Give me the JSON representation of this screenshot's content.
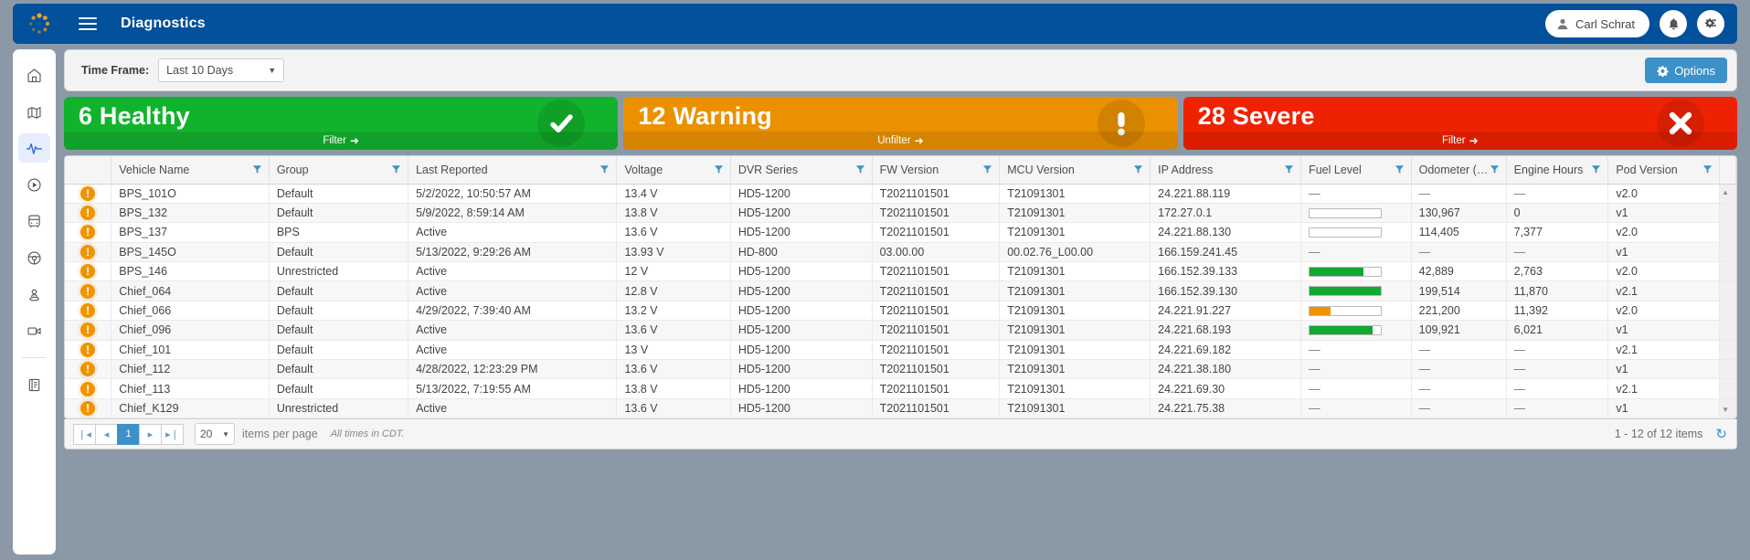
{
  "topbar": {
    "logo": "spinner-logo",
    "menu_icon": "hamburger-menu-icon",
    "title": "Diagnostics",
    "user_name": "Carl Schrat",
    "user_icon": "user-icon",
    "bell_icon": "bell-icon",
    "gear_icon": "gear-icon"
  },
  "sidebar": {
    "items": [
      {
        "name": "home",
        "icon": "home-icon",
        "active": false
      },
      {
        "name": "map",
        "icon": "map-icon",
        "active": false
      },
      {
        "name": "diagnostics",
        "icon": "pulse-icon",
        "active": true
      },
      {
        "name": "playback",
        "icon": "play-circle-icon",
        "active": false
      },
      {
        "name": "vehicles",
        "icon": "bus-icon",
        "active": false
      },
      {
        "name": "drivers",
        "icon": "steering-wheel-icon",
        "active": false
      },
      {
        "name": "students",
        "icon": "person-pin-icon",
        "active": false
      },
      {
        "name": "video",
        "icon": "video-camera-icon",
        "active": false
      },
      {
        "name": "reports",
        "icon": "report-book-icon",
        "active": false
      }
    ]
  },
  "filterbar": {
    "time_frame_label": "Time Frame:",
    "time_frame_value": "Last 10 Days",
    "options_label": "Options",
    "options_icon": "gear-icon"
  },
  "cards": [
    {
      "count": "6",
      "label": "Healthy",
      "title": "6 Healthy",
      "action": "Filter",
      "arrow": "→",
      "icon": "check-circle-icon",
      "color": "#12b32c"
    },
    {
      "count": "12",
      "label": "Warning",
      "title": "12 Warning",
      "action": "Unfilter",
      "arrow": "→",
      "icon": "exclamation-icon",
      "color": "#eb9100"
    },
    {
      "count": "28",
      "label": "Severe",
      "title": "28 Severe",
      "action": "Filter",
      "arrow": "→",
      "icon": "x-circle-icon",
      "color": "#ef2200"
    }
  ],
  "table": {
    "columns": [
      {
        "label": "",
        "filterable": false
      },
      {
        "label": "Vehicle Name",
        "filterable": true
      },
      {
        "label": "Group",
        "filterable": true
      },
      {
        "label": "Last Reported",
        "filterable": true
      },
      {
        "label": "Voltage",
        "filterable": true
      },
      {
        "label": "DVR Series",
        "filterable": true
      },
      {
        "label": "FW Version",
        "filterable": true
      },
      {
        "label": "MCU Version",
        "filterable": true
      },
      {
        "label": "IP Address",
        "filterable": true
      },
      {
        "label": "Fuel Level",
        "filterable": true
      },
      {
        "label": "Odometer (…",
        "filterable": true
      },
      {
        "label": "Engine Hours",
        "filterable": true
      },
      {
        "label": "Pod Version",
        "filterable": true
      }
    ],
    "rows": [
      {
        "status": "warning",
        "vehicle_name": "BPS_101O",
        "group": "Default",
        "last_reported": "5/2/2022, 10:50:57 AM",
        "voltage": "13.4 V",
        "dvr_series": "HD5-1200",
        "fw_version": "T2021101501",
        "mcu_version": "T21091301",
        "ip_address": "24.221.88.119",
        "fuel_level": null,
        "fuel_text": "—",
        "odometer": "—",
        "engine_hours": "—",
        "pod_version": "v2.0"
      },
      {
        "status": "warning",
        "vehicle_name": "BPS_132",
        "group": "Default",
        "last_reported": "5/9/2022, 8:59:14 AM",
        "voltage": "13.8 V",
        "dvr_series": "HD5-1200",
        "fw_version": "T2021101501",
        "mcu_version": "T21091301",
        "ip_address": "172.27.0.1",
        "fuel_level": 0,
        "fuel_text": "",
        "odometer": "130,967",
        "engine_hours": "0",
        "pod_version": "v1"
      },
      {
        "status": "warning",
        "vehicle_name": "BPS_137",
        "group": "BPS",
        "last_reported": "Active",
        "voltage": "13.6 V",
        "dvr_series": "HD5-1200",
        "fw_version": "T2021101501",
        "mcu_version": "T21091301",
        "ip_address": "24.221.88.130",
        "fuel_level": 0,
        "fuel_text": "",
        "odometer": "114,405",
        "engine_hours": "7,377",
        "pod_version": "v2.0"
      },
      {
        "status": "warning",
        "vehicle_name": "BPS_145O",
        "group": "Default",
        "last_reported": "5/13/2022, 9:29:26 AM",
        "voltage": "13.93 V",
        "dvr_series": "HD-800",
        "fw_version": "03.00.00",
        "mcu_version": "00.02.76_L00.00",
        "ip_address": "166.159.241.45",
        "fuel_level": null,
        "fuel_text": "—",
        "odometer": "—",
        "engine_hours": "—",
        "pod_version": "v1"
      },
      {
        "status": "warning",
        "vehicle_name": "BPS_146",
        "group": "Unrestricted",
        "last_reported": "Active",
        "voltage": "12 V",
        "dvr_series": "HD5-1200",
        "fw_version": "T2021101501",
        "mcu_version": "T21091301",
        "ip_address": "166.152.39.133",
        "fuel_level": 75,
        "fuel_color": "#12a833",
        "fuel_text": "",
        "odometer": "42,889",
        "engine_hours": "2,763",
        "pod_version": "v2.0"
      },
      {
        "status": "warning",
        "vehicle_name": "Chief_064",
        "group": "Default",
        "last_reported": "Active",
        "voltage": "12.8 V",
        "dvr_series": "HD5-1200",
        "fw_version": "T2021101501",
        "mcu_version": "T21091301",
        "ip_address": "166.152.39.130",
        "fuel_level": 100,
        "fuel_color": "#12a833",
        "fuel_text": "",
        "odometer": "199,514",
        "engine_hours": "11,870",
        "pod_version": "v2.1"
      },
      {
        "status": "warning",
        "vehicle_name": "Chief_066",
        "group": "Default",
        "last_reported": "4/29/2022, 7:39:40 AM",
        "voltage": "13.2 V",
        "dvr_series": "HD5-1200",
        "fw_version": "T2021101501",
        "mcu_version": "T21091301",
        "ip_address": "24.221.91.227",
        "fuel_level": 29,
        "fuel_color": "#ef9400",
        "fuel_text": "",
        "odometer": "221,200",
        "engine_hours": "11,392",
        "pod_version": "v2.0"
      },
      {
        "status": "warning",
        "vehicle_name": "Chief_096",
        "group": "Default",
        "last_reported": "Active",
        "voltage": "13.6 V",
        "dvr_series": "HD5-1200",
        "fw_version": "T2021101501",
        "mcu_version": "T21091301",
        "ip_address": "24.221.68.193",
        "fuel_level": 88,
        "fuel_color": "#12a833",
        "fuel_text": "",
        "odometer": "109,921",
        "engine_hours": "6,021",
        "pod_version": "v1"
      },
      {
        "status": "warning",
        "vehicle_name": "Chief_101",
        "group": "Default",
        "last_reported": "Active",
        "voltage": "13 V",
        "dvr_series": "HD5-1200",
        "fw_version": "T2021101501",
        "mcu_version": "T21091301",
        "ip_address": "24.221.69.182",
        "fuel_level": null,
        "fuel_text": "—",
        "odometer": "—",
        "engine_hours": "—",
        "pod_version": "v2.1"
      },
      {
        "status": "warning",
        "vehicle_name": "Chief_112",
        "group": "Default",
        "last_reported": "4/28/2022, 12:23:29 PM",
        "voltage": "13.6 V",
        "dvr_series": "HD5-1200",
        "fw_version": "T2021101501",
        "mcu_version": "T21091301",
        "ip_address": "24.221.38.180",
        "fuel_level": null,
        "fuel_text": "—",
        "odometer": "—",
        "engine_hours": "—",
        "pod_version": "v1"
      },
      {
        "status": "warning",
        "vehicle_name": "Chief_113",
        "group": "Default",
        "last_reported": "5/13/2022, 7:19:55 AM",
        "voltage": "13.8 V",
        "dvr_series": "HD5-1200",
        "fw_version": "T2021101501",
        "mcu_version": "T21091301",
        "ip_address": "24.221.69.30",
        "fuel_level": null,
        "fuel_text": "—",
        "odometer": "—",
        "engine_hours": "—",
        "pod_version": "v2.1"
      },
      {
        "status": "warning",
        "vehicle_name": "Chief_K129",
        "group": "Unrestricted",
        "last_reported": "Active",
        "voltage": "13.6 V",
        "dvr_series": "HD5-1200",
        "fw_version": "T2021101501",
        "mcu_version": "T21091301",
        "ip_address": "24.221.75.38",
        "fuel_level": null,
        "fuel_text": "—",
        "odometer": "—",
        "engine_hours": "—",
        "pod_version": "v1"
      }
    ]
  },
  "footer": {
    "first_label": "❘◂",
    "prev_label": "◂",
    "current_page": "1",
    "next_label": "▸",
    "last_label": "▸❘",
    "items_per_page_value": "20",
    "items_per_page_label": "items per page",
    "timezone_note": "All times in CDT.",
    "item_count": "1 - 12 of 12 items",
    "refresh_icon": "refresh-icon"
  }
}
